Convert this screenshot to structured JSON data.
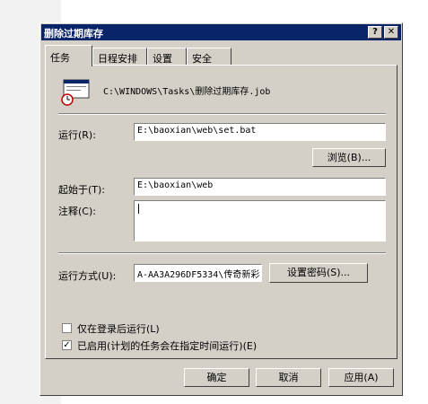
{
  "window": {
    "title": "删除过期库存",
    "help_btn": "?",
    "close_btn": "✕"
  },
  "tabs": [
    {
      "label": "任务",
      "active": true
    },
    {
      "label": "日程安排",
      "active": false
    },
    {
      "label": "设置",
      "active": false
    },
    {
      "label": "安全",
      "active": false
    }
  ],
  "task": {
    "file_path": "C:\\WINDOWS\\Tasks\\删除过期库存.job",
    "run_label": "运行(R):",
    "run_value": "E:\\baoxian\\web\\set.bat",
    "browse_button": "浏览(B)...",
    "start_in_label": "起始于(T):",
    "start_in_value": "E:\\baoxian\\web",
    "comment_label": "注释(C):",
    "comment_value": "",
    "run_as_label": "运行方式(U):",
    "run_as_value": "A-AA3A296DF5334\\传奇新彩",
    "set_password_button": "设置密码(S)...",
    "only_logged_on_label": "仅在登录后运行(L)",
    "only_logged_on_checked": false,
    "enabled_label": "已启用(计划的任务会在指定时间运行)(E)",
    "enabled_checked": true
  },
  "footer": {
    "ok": "确定",
    "cancel": "取消",
    "apply": "应用(A)"
  },
  "icons": {
    "task_file_icon": "scheduled-task-icon"
  }
}
